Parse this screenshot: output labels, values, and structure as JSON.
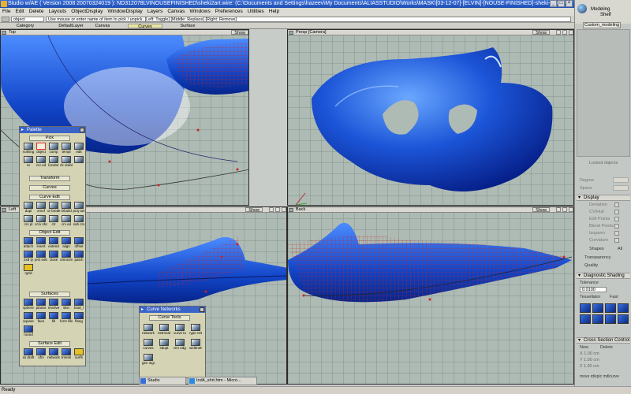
{
  "window": {
    "title": "Studio w/AE ( Version 2008  20070324019 ): ND312078LVINOUSEFINISHED\\sheki2art.wire: (C:\\Documents and Settings\\hazeev\\My Documents\\ALIASSTUDIO\\Works\\MASK\\[03-12-07]-[ELVIN]-[NOUSE-FINISHED]-sheki-2art.wire",
    "minimize": "_",
    "maximize": "□",
    "close": "×"
  },
  "menu": [
    "File",
    "Edit",
    "Delete",
    "Layouts",
    "ObjectDisplay",
    "WindowDisplay",
    "Layers",
    "Canvas",
    "Windows",
    "Preferences",
    "Utilities",
    "Help"
  ],
  "command": {
    "field_value": "object",
    "prompt": "Use mouse or enter name of item to pick / unpick. [Left: Toggle] [Middle: Replace] [Right: Remove]"
  },
  "tabs": [
    "Category",
    "DefaultLayer",
    "Canvas",
    "Curves",
    "Surface"
  ],
  "active_tab": "Curves",
  "viewports": {
    "top": {
      "label": "Top",
      "show": "Show"
    },
    "persp": {
      "label": "Persp [Camera]",
      "show": "Show"
    },
    "left": {
      "label": "Left",
      "show": "Show"
    },
    "back": {
      "label": "Back",
      "show": "Show"
    }
  },
  "palette": {
    "title": "Palette",
    "sections": {
      "pick": "Pick",
      "transform": "Transform",
      "curves": "Curves",
      "curve_edit": "Curve Edit",
      "object_edit": "Object Edit",
      "surfaces": "Surfaces",
      "surface_edit": "Surface Edit"
    },
    "pick_labels": [
      "nothing",
      "object",
      "comp",
      "templ",
      "edit",
      "cv",
      "crv ed",
      "locator",
      "ck visibl",
      ""
    ],
    "curve_edit_labels": [
      "dupl",
      "xrsof",
      "or break",
      "rebuild",
      "proj tan",
      "crv pl",
      "ccrv sharp",
      "ctr",
      "crv ed",
      "sub crv",
      "crv alt",
      "ch"
    ],
    "object_edit_labels": [
      "attach",
      "insert",
      "extend",
      "align",
      "offset",
      "2x8 ty",
      "ject edit",
      "close",
      "omrosm",
      "patch",
      "rgrid",
      "",
      "",
      "",
      ""
    ],
    "surface_labels": [
      "sphere",
      "planar",
      "revolve",
      "skin",
      "brail_l",
      "square",
      "face",
      "fill",
      "form fillet",
      "flang",
      "round",
      "",
      "",
      "",
      ""
    ],
    "surface_edit_labels": [
      "ss draft",
      "ofrv",
      "network",
      "trimsb",
      "surfs",
      "",
      "",
      "",
      "",
      ""
    ]
  },
  "curve_networks": {
    "title": "Curve Networks",
    "section": "Curve Tools",
    "labels": [
      "network",
      "netmnal",
      "curve to",
      "rype net",
      "curves",
      "sdupt",
      "cim edgeit",
      "weldnetwk",
      "gen ings"
    ]
  },
  "right_panel": {
    "shelf_line1": "Modeling",
    "shelf_line2": "Shelf",
    "tab": "Custom_modeling",
    "locked": "Locked objects",
    "degree_label": "Degree",
    "spans_label": "Spans",
    "display_header": "Display",
    "display_items": [
      "Deviation",
      "CV/Hull",
      "Edit Points",
      "Blend Points",
      "Isoparm",
      "Curvature"
    ],
    "shapes_label": "Shapes",
    "shapes_value": "All",
    "transparency_label": "Transparency",
    "quality_label": "Quality",
    "diagnostic_header": "Diagnostic Shading",
    "tolerance_label": "Tolerance",
    "tolerance_value": "0.0100",
    "tessellator_label": "Tessellator",
    "tessellator_value": "Fast",
    "cross_header": "Cross Section Control",
    "new_label": "New",
    "delete_label": "Delete",
    "x_value": "X 1.00 cm",
    "y_value": "Y 1.00 cm",
    "z_value": "Z 1.00 cm",
    "bottom_labels": "move rdisplc mdlcurve"
  },
  "taskbar": [
    {
      "label": "Studio",
      "icon": "alias-icon"
    },
    {
      "label": "Ind4_shrt.htm - Micro...",
      "icon": "ie-icon"
    }
  ],
  "status": "Ready"
}
